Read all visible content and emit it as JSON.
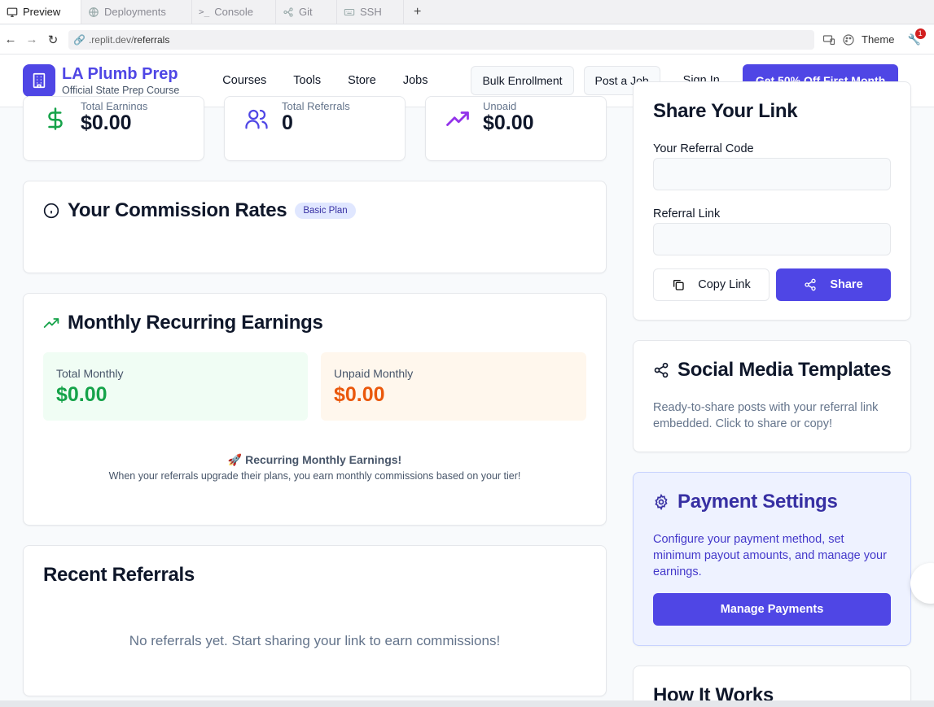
{
  "tabs": [
    {
      "label": "Preview",
      "icon": "monitor-icon",
      "active": true
    },
    {
      "label": "Deployments",
      "icon": "globe-icon"
    },
    {
      "label": "Console",
      "icon": "terminal-icon"
    },
    {
      "label": "Git",
      "icon": "git-icon"
    },
    {
      "label": "SSH",
      "icon": "keyboard-icon"
    }
  ],
  "address": {
    "host": ".replit.dev/",
    "path": "referrals"
  },
  "theme_label": "Theme",
  "notif_count": "1",
  "brand": {
    "name": "LA Plumb Prep",
    "tagline": "Official State Prep Course"
  },
  "nav": {
    "items": [
      "Courses",
      "Tools",
      "Store",
      "Jobs"
    ],
    "bulk": "Bulk Enrollment",
    "post_job": "Post a Job",
    "sign_in": "Sign In",
    "cta": "Get 50% Off First Month"
  },
  "stats": [
    {
      "label": "Total Earnings",
      "value": "$0.00",
      "icon": "dollar-icon",
      "color": "#16a34a"
    },
    {
      "label": "Total Referrals",
      "value": "0",
      "icon": "users-icon",
      "color": "#4f46e5"
    },
    {
      "label": "Unpaid",
      "value": "$0.00",
      "icon": "trending-up-icon",
      "color": "#9333ea"
    }
  ],
  "commission": {
    "title": "Your Commission Rates",
    "plan_badge": "Basic Plan"
  },
  "monthly": {
    "title": "Monthly Recurring Earnings",
    "total_label": "Total Monthly",
    "total_value": "$0.00",
    "unpaid_label": "Unpaid Monthly",
    "unpaid_value": "$0.00",
    "note_title": "Recurring Monthly Earnings!",
    "note_text": "When your referrals upgrade their plans, you earn monthly commissions based on your tier!"
  },
  "recent": {
    "title": "Recent Referrals",
    "empty": "No referrals yet. Start sharing your link to earn commissions!"
  },
  "share": {
    "title": "Share Your Link",
    "code_label": "Your Referral Code",
    "link_label": "Referral Link",
    "copy": "Copy Link",
    "share": "Share"
  },
  "social": {
    "title": "Social Media Templates",
    "desc": "Ready-to-share posts with your referral link embedded. Click to share or copy!"
  },
  "payment": {
    "title": "Payment Settings",
    "desc": "Configure your payment method, set minimum payout amounts, and manage your earnings.",
    "button": "Manage Payments"
  },
  "how": {
    "title": "How It Works"
  },
  "colors": {
    "primary": "#4f46e5",
    "green": "#16a34a",
    "orange": "#ea580c",
    "purple": "#9333ea"
  }
}
